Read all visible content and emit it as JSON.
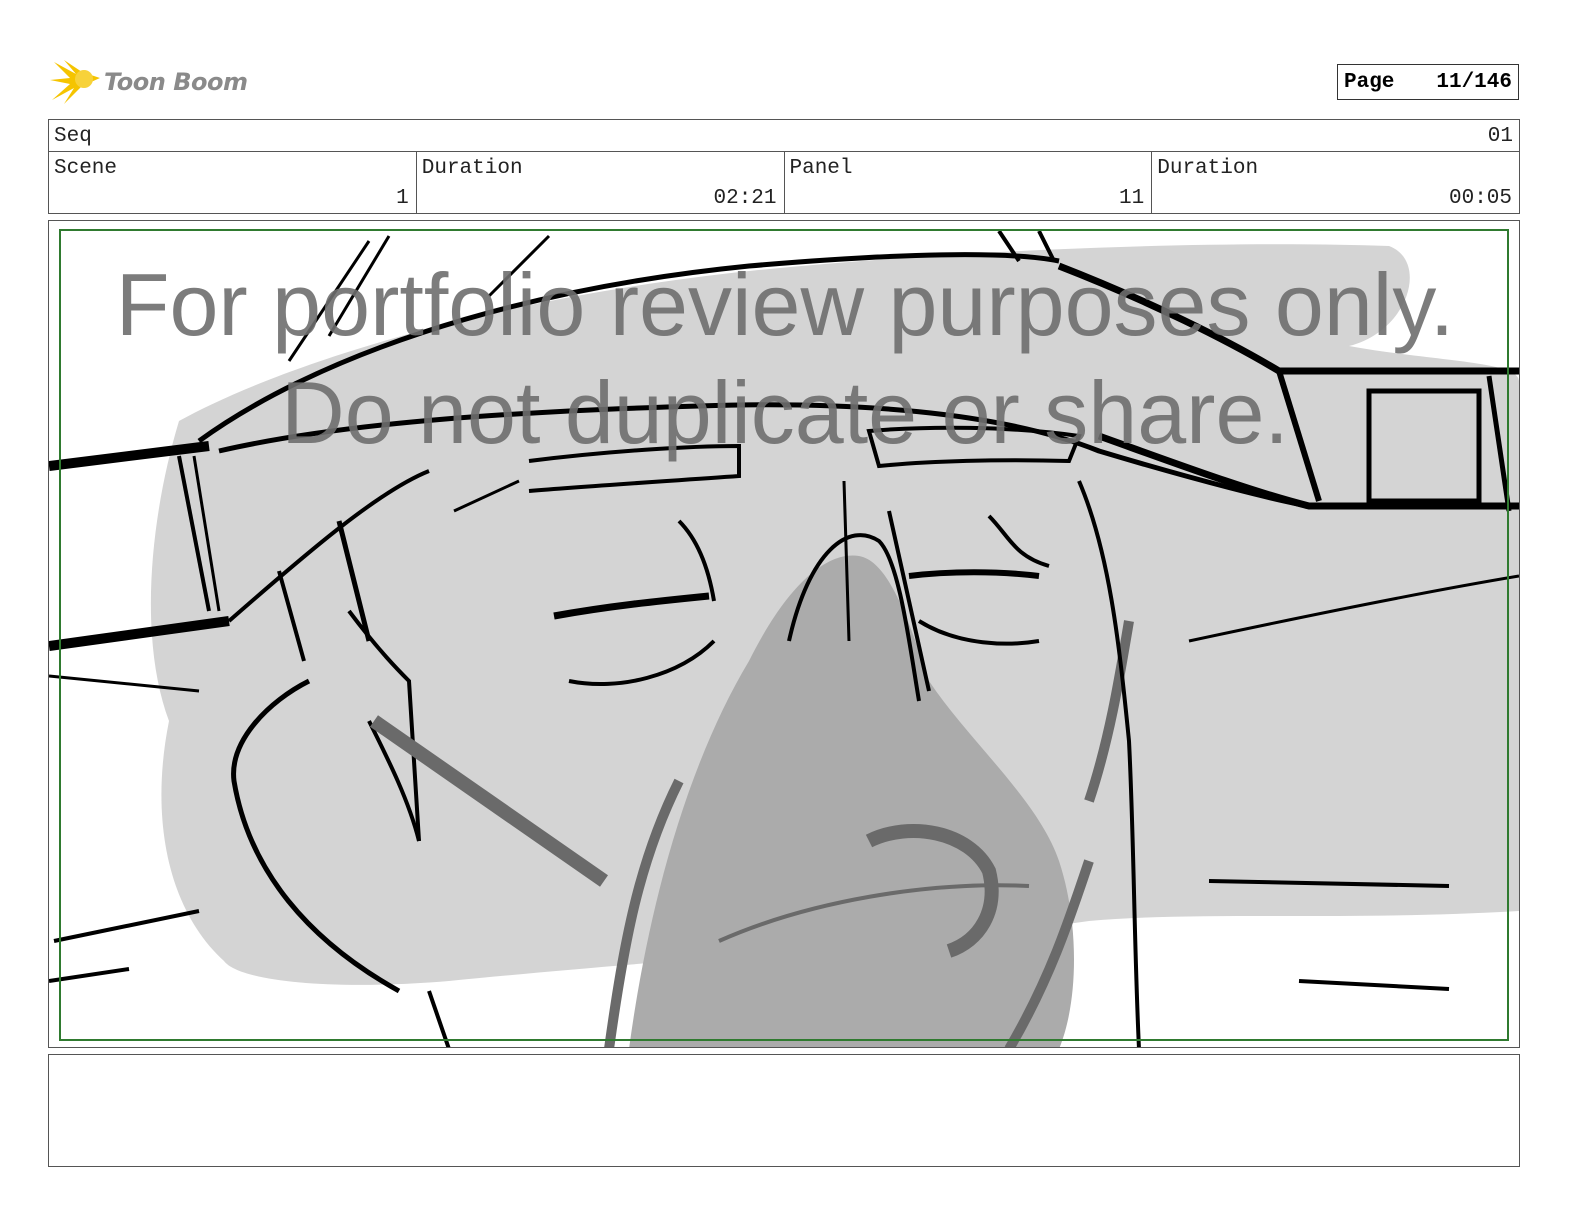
{
  "header": {
    "logo_text": "Toon Boom",
    "page_label": "Page",
    "page_value": "11/146"
  },
  "sequence": {
    "label": "Seq",
    "value": "01"
  },
  "info": [
    {
      "label": "Scene",
      "value": "1"
    },
    {
      "label": "Duration",
      "value": "02:21"
    },
    {
      "label": "Panel",
      "value": "11"
    },
    {
      "label": "Duration",
      "value": "00:05"
    }
  ],
  "panel": {
    "watermark_line1": "For portfolio review purposes only.",
    "watermark_line2": "Do not duplicate or share."
  },
  "notes": {
    "text": ""
  },
  "colors": {
    "logo_accent": "#f5c400",
    "safe_frame": "#2f7a2f",
    "sketch_fill": "#d4d4d4",
    "sketch_dark_fill": "#ababab",
    "sketch_line": "#000000"
  }
}
